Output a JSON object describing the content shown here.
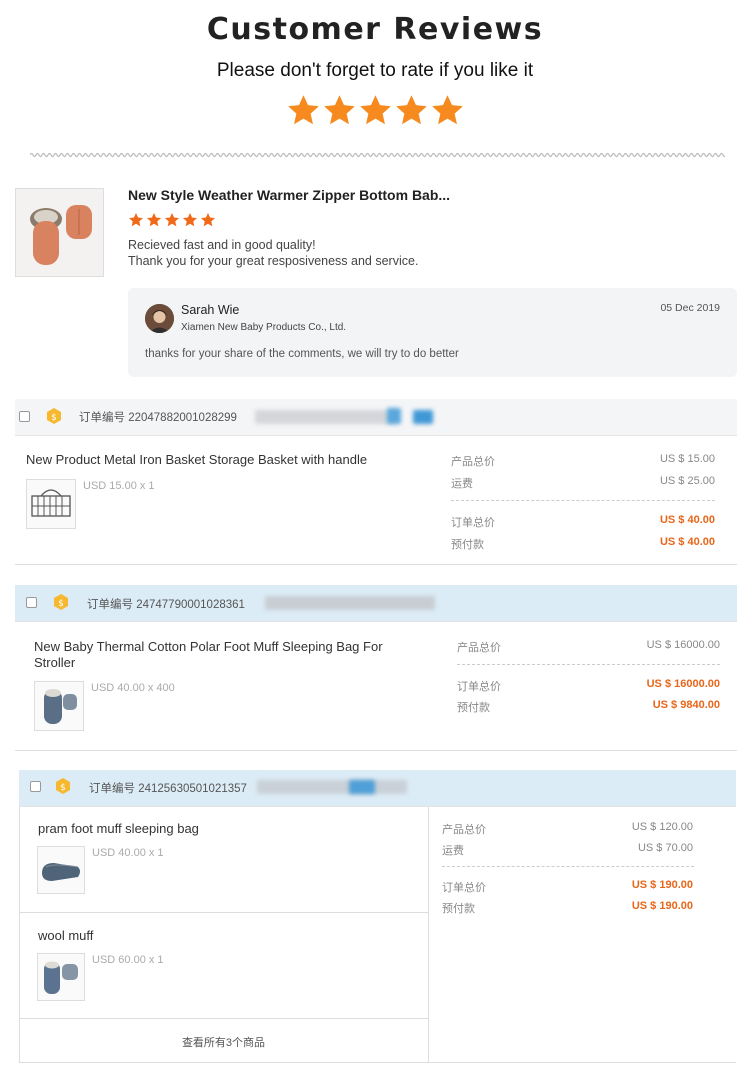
{
  "header": {
    "title": "Customer Reviews",
    "subtitle": "Please don't forget to rate if you like it",
    "star_rating": 5,
    "star_color": "#f68a1e"
  },
  "review": {
    "product_title": "New Style Weather Warmer Zipper Bottom Bab...",
    "rating": 5,
    "star_color": "#f06a1a",
    "lines": [
      "Recieved fast and in good quality!",
      "Thank you for your great resposiveness and service."
    ],
    "reply": {
      "name": "Sarah Wie",
      "company": "Xiamen New Baby Products Co., Ltd.",
      "date": "05 Dec 2019",
      "text": "thanks for your share of the comments, we will try to do better"
    }
  },
  "orders": [
    {
      "label": "订单编号 22047882001028299",
      "items": [
        {
          "name": "New Product Metal Iron Basket Storage Basket with handle",
          "price": "USD 15.00 x 1",
          "icon": "basket-icon"
        }
      ],
      "summary": {
        "rows": [
          {
            "label": "产品总价",
            "value": "US $ 15.00"
          },
          {
            "label": "运费",
            "value": "US $ 25.00"
          }
        ],
        "totals": [
          {
            "label": "订单总价",
            "value": "US $ 40.00"
          },
          {
            "label": "预付款",
            "value": "US $ 40.00"
          }
        ]
      }
    },
    {
      "label": "订单编号 24747790001028361",
      "items": [
        {
          "name": "New Baby Thermal Cotton Polar Foot Muff Sleeping Bag For Stroller",
          "price": "USD 40.00 x 400",
          "icon": "sleeping-bag-icon"
        }
      ],
      "summary": {
        "rows": [
          {
            "label": "产品总价",
            "value": "US $ 16000.00"
          }
        ],
        "totals": [
          {
            "label": "订单总价",
            "value": "US $ 16000.00"
          },
          {
            "label": "预付款",
            "value": "US $ 9840.00"
          }
        ]
      }
    },
    {
      "label": "订单编号 24125630501021357",
      "items": [
        {
          "name": "pram foot muff sleeping bag",
          "price": "USD 40.00 x 1",
          "icon": "foot-muff-icon"
        },
        {
          "name": "wool muff",
          "price": "USD 60.00 x 1",
          "icon": "wool-muff-icon"
        }
      ],
      "view_all": "查看所有3个商品",
      "summary": {
        "rows": [
          {
            "label": "产品总价",
            "value": "US $ 120.00"
          },
          {
            "label": "运费",
            "value": "US $ 70.00"
          }
        ],
        "totals": [
          {
            "label": "订单总价",
            "value": "US $ 190.00"
          },
          {
            "label": "预付款",
            "value": "US $ 190.00"
          }
        ]
      }
    }
  ],
  "colors": {
    "order_header_gray": "#f4f5f7",
    "order_header_blue": "#dcecf6",
    "accent_orange": "#e8661a",
    "badge_yellow": "#f5b82e"
  }
}
